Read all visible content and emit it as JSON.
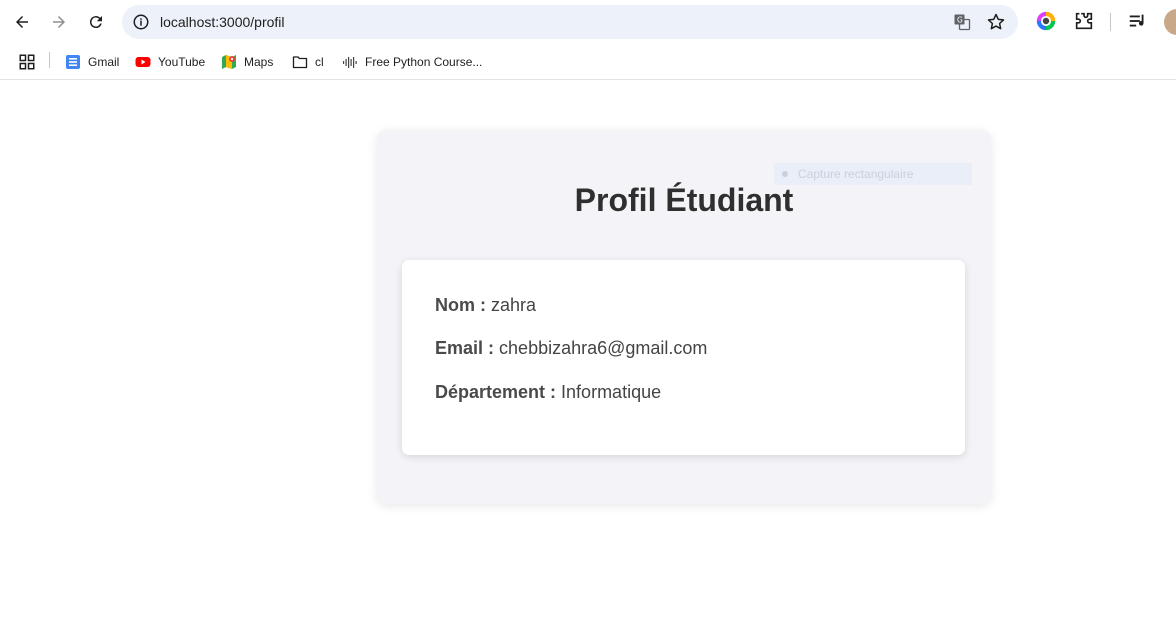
{
  "browser": {
    "url": "localhost:3000/profil",
    "bookmarks": [
      {
        "label": "Gmail",
        "icon": "gmail-icon"
      },
      {
        "label": "YouTube",
        "icon": "youtube-icon"
      },
      {
        "label": "Maps",
        "icon": "maps-icon"
      },
      {
        "label": "cl",
        "icon": "folder-icon"
      },
      {
        "label": "Free Python Course...",
        "icon": "cisco-icon"
      }
    ]
  },
  "page": {
    "overlay_text": "Capture rectangulaire",
    "title": "Profil Étudiant",
    "fields": [
      {
        "label": "Nom :",
        "value": "zahra"
      },
      {
        "label": "Email :",
        "value": "chebbizahra6@gmail.com"
      },
      {
        "label": "Département :",
        "value": "Informatique"
      }
    ]
  },
  "colors": {
    "card_bg": "#f4f4f8",
    "omnibox_bg": "#edf1f9",
    "title_text": "#2f2f2f"
  }
}
